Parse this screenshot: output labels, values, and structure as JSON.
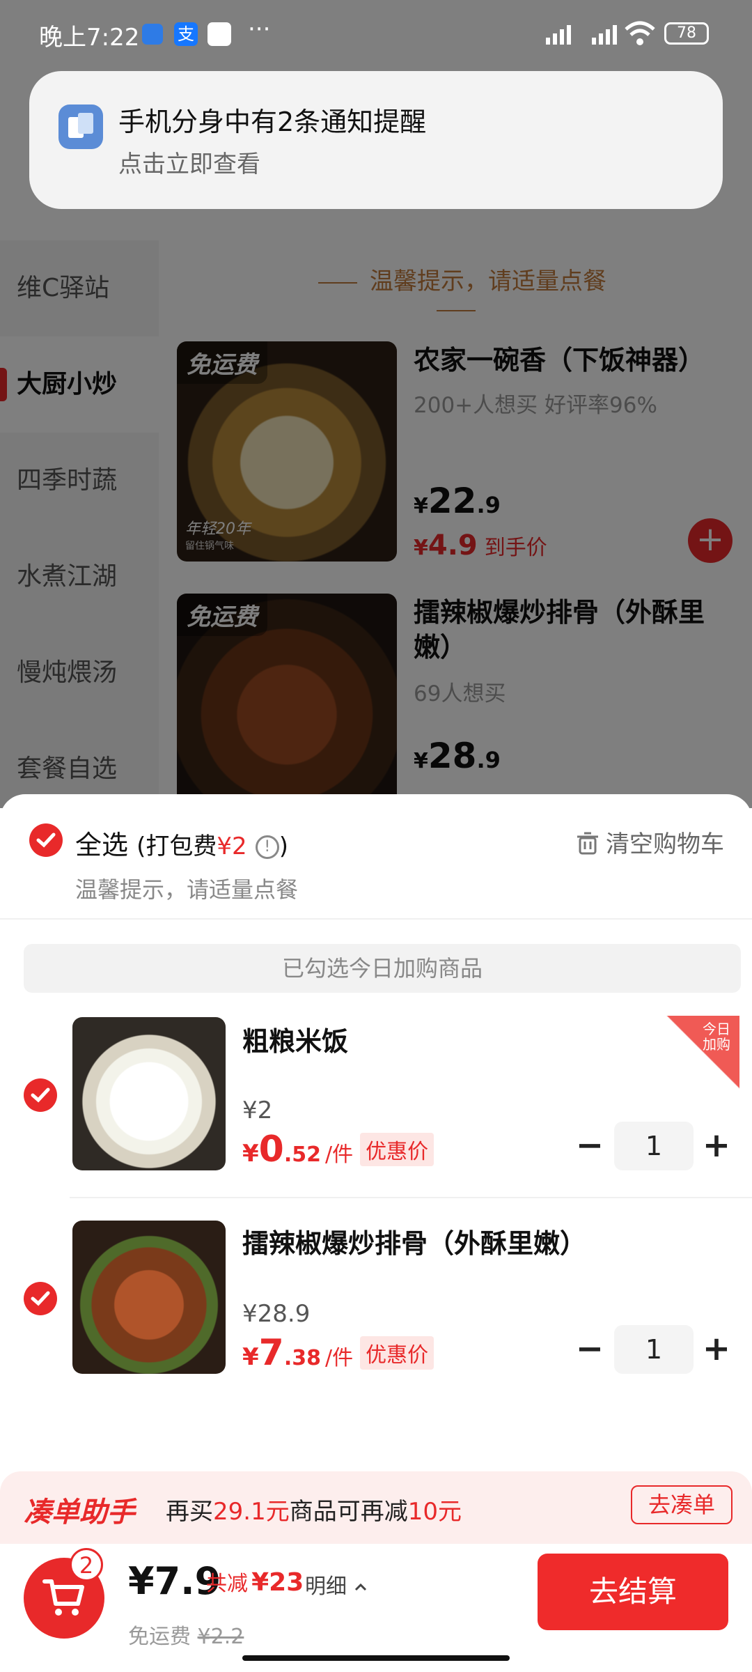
{
  "status_bar": {
    "time": "晚上7:22",
    "more": "···",
    "battery": "78"
  },
  "notification": {
    "title": "手机分身中有2条通知提醒",
    "subtitle": "点击立即查看"
  },
  "background": {
    "categories": [
      "维C驿站",
      "大厨小炒",
      "四季时蔬",
      "水煮江湖",
      "慢炖煨汤",
      "套餐自选"
    ],
    "active_category": "大厨小炒",
    "tip": "温馨提示，请适量点餐",
    "dishes": [
      {
        "tag": "免运费",
        "name": "农家一碗香（下饭神器）",
        "sub": "200+人想买 好评率96%",
        "price_int": "22",
        "price_dec": ".9",
        "deal": "4.9",
        "deal_label": "到手价"
      },
      {
        "tag": "免运费",
        "name": "擂辣椒爆炒排骨（外酥里嫩）",
        "sub": "69人想买",
        "price_int": "28",
        "price_dec": ".9"
      }
    ],
    "brand_mark": "年轻20年",
    "brand_sub": "留住锅气味"
  },
  "sheet": {
    "select_all": "全选",
    "packing_fee_label": "(打包费",
    "packing_fee": "¥2",
    "packing_fee_close": ")",
    "clear_cart": "清空购物车",
    "tip": "温馨提示，请适量点餐",
    "selected_today": "已勾选今日加购商品",
    "today_ribbon": "今日加购",
    "items": [
      {
        "name": "粗粮米饭",
        "orig_price": "¥2",
        "deal_cur": "¥",
        "deal_int": "0",
        "deal_dec": ".52",
        "unit": "/件",
        "badge": "优惠价",
        "qty": "1"
      },
      {
        "name": "擂辣椒爆炒排骨（外酥里嫩）",
        "orig_price": "¥28.9",
        "deal_cur": "¥",
        "deal_int": "7",
        "deal_dec": ".38",
        "unit": "/件",
        "badge": "优惠价",
        "qty": "1"
      }
    ]
  },
  "helper": {
    "title": "凑单助手",
    "text_a": "再买",
    "amount": "29.1元",
    "text_b": "商品可再减",
    "discount": "10元",
    "button": "去凑单"
  },
  "checkout": {
    "badge": "2",
    "total": "¥7.9",
    "saved_label": "共减",
    "saved": "¥23",
    "detail": "明细",
    "shipping_label": "免运费",
    "shipping_orig": "¥2.2",
    "button": "去结算"
  },
  "colors": {
    "accent": "#e8292a",
    "tip": "#c07b3c",
    "helper_bg": "#fdeeed"
  }
}
